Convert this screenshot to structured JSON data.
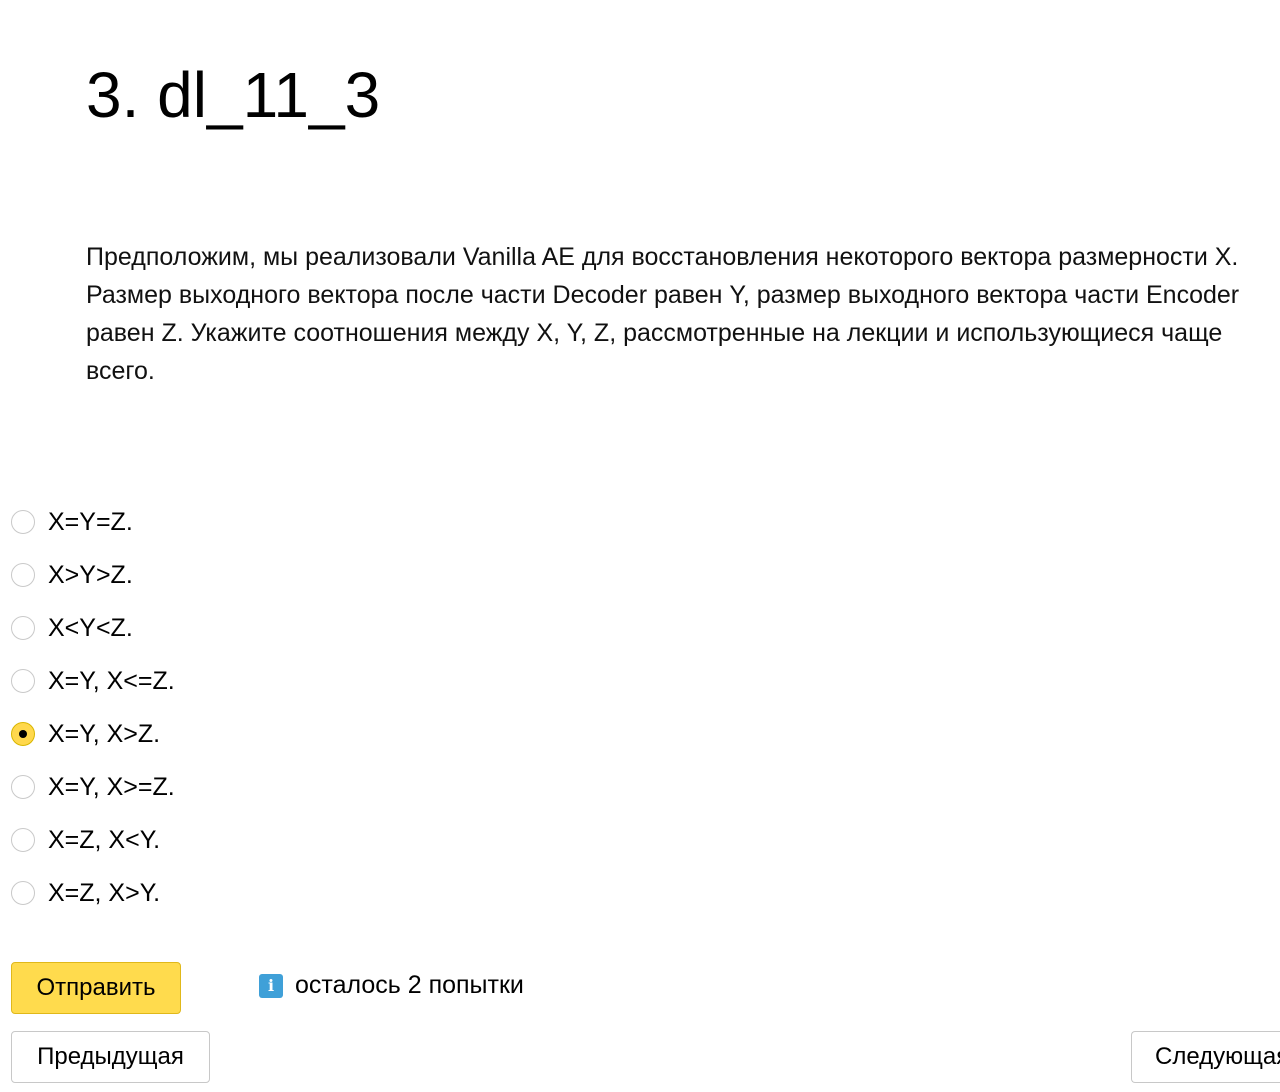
{
  "header": {
    "title": "3. dl_11_3"
  },
  "question": {
    "text": "Предположим, мы реализовали Vanilla AE для восстановления некоторого вектора размерности X. Размер выходного вектора после части Decoder равен Y, размер выходного вектора части Encoder равен Z. Укажите соотношения между X, Y, Z, рассмотренные на лекции и использующиеся чаще всего."
  },
  "options": [
    {
      "label": "X=Y=Z.",
      "selected": false
    },
    {
      "label": "X>Y>Z.",
      "selected": false
    },
    {
      "label": "X<Y<Z.",
      "selected": false
    },
    {
      "label": "X=Y, X<=Z.",
      "selected": false
    },
    {
      "label": "X=Y, X>Z.",
      "selected": true
    },
    {
      "label": "X=Y, X>=Z.",
      "selected": false
    },
    {
      "label": "X=Z, X<Y.",
      "selected": false
    },
    {
      "label": "X=Z, X>Y.",
      "selected": false
    }
  ],
  "actions": {
    "submit_label": "Отправить",
    "attempts_text": "осталось 2 попытки",
    "info_icon": "info-icon",
    "info_glyph": "i",
    "prev_label": "Предыдущая",
    "next_label": "Следующая"
  },
  "colors": {
    "submit_bg": "#ffdb4d",
    "info_icon_bg": "#3fa0d8",
    "radio_checked": "#ffd84d"
  }
}
